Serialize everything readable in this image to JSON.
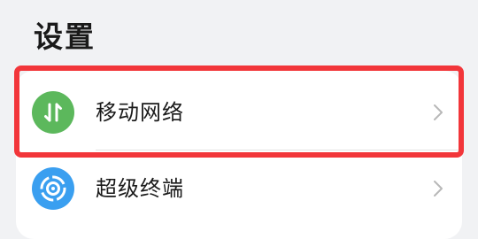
{
  "page": {
    "title": "设置"
  },
  "settings_list": {
    "items": [
      {
        "label": "移动网络",
        "icon": "mobile-data-icon",
        "icon_color": "#5cb85c",
        "selected": true
      },
      {
        "label": "超级终端",
        "icon": "super-device-icon",
        "icon_color": "#3a9ff0"
      }
    ]
  },
  "colors": {
    "background": "#f1f2f4",
    "card": "#ffffff",
    "highlight": "#f2363a",
    "chevron": "#b8b8b8"
  }
}
